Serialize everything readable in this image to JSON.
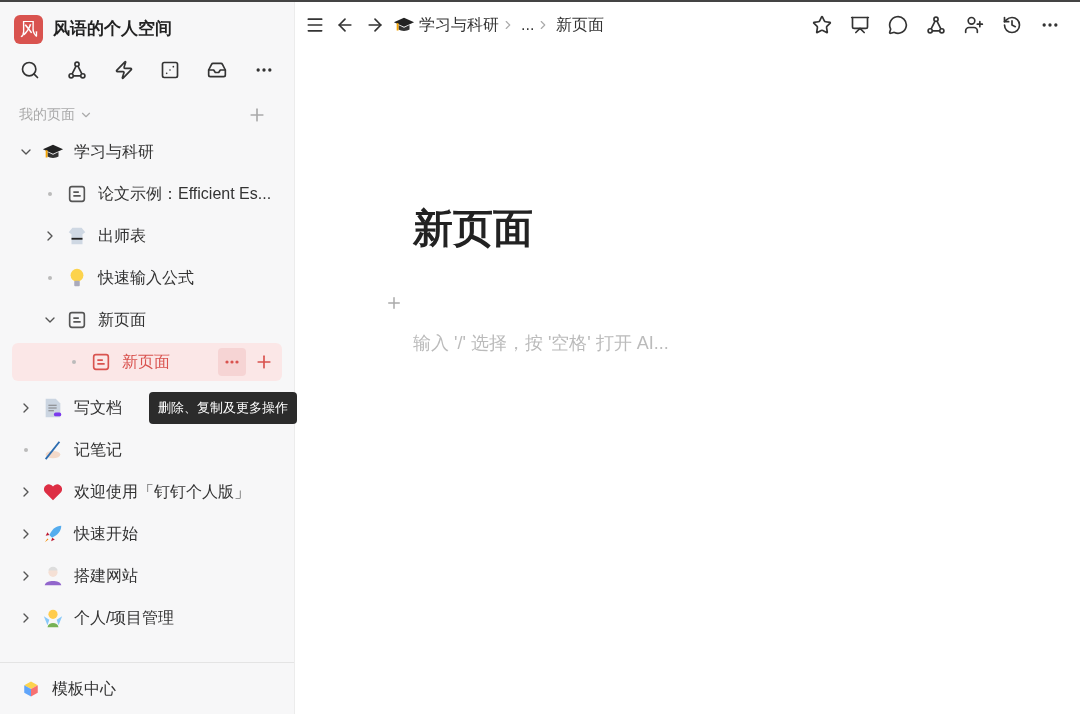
{
  "workspace": {
    "logo": "风",
    "name": "风语的个人空间"
  },
  "section": {
    "title": "我的页面"
  },
  "tree": [
    {
      "label": "学习与科研",
      "kind": "grad-cap",
      "expanded": true,
      "selected": false,
      "children": [
        {
          "label": "论文示例：Efficient Es...",
          "kind": "doc",
          "selected": false
        },
        {
          "label": "出师表",
          "kind": "uniform",
          "expanded": false,
          "selected": false
        },
        {
          "label": "快速输入公式",
          "kind": "bulb",
          "selected": false
        },
        {
          "label": "新页面",
          "kind": "doc",
          "expanded": true,
          "selected": false,
          "children": [
            {
              "label": "新页面",
              "kind": "doc",
              "selected": true
            }
          ]
        }
      ]
    },
    {
      "label": "写文档",
      "kind": "file",
      "expanded": false,
      "selected": false
    },
    {
      "label": "记笔记",
      "kind": "pen",
      "selected": false
    },
    {
      "label": "欢迎使用「钉钉个人版」",
      "kind": "heart",
      "expanded": false,
      "selected": false
    },
    {
      "label": "快速开始",
      "kind": "rocket",
      "expanded": false,
      "selected": false
    },
    {
      "label": "搭建网站",
      "kind": "artist",
      "expanded": false,
      "selected": false
    },
    {
      "label": "个人/项目管理",
      "kind": "fairy",
      "expanded": false,
      "selected": false
    }
  ],
  "tooltip": "删除、复制及更多操作",
  "footer": {
    "label": "模板中心"
  },
  "breadcrumb": [
    {
      "label": "学习与科研",
      "kind": "grad-cap"
    },
    {
      "label": "...",
      "kind": "text"
    },
    {
      "label": "新页面",
      "kind": "text"
    }
  ],
  "page": {
    "title": "新页面",
    "placeholder": "输入 '/' 选择，按 '空格' 打开 AI..."
  }
}
